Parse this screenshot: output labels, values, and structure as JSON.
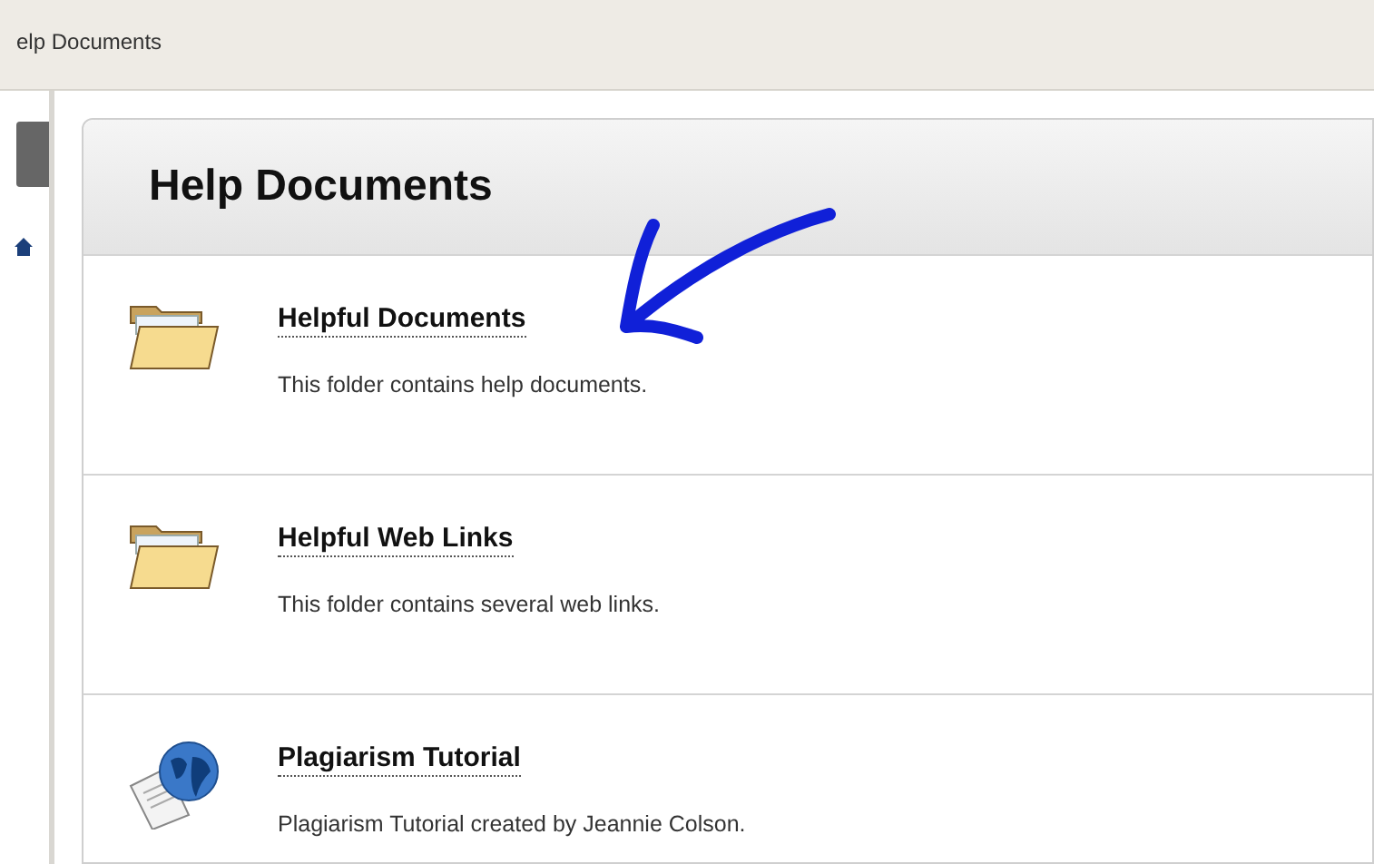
{
  "breadcrumb": "elp Documents",
  "page": {
    "title": "Help Documents"
  },
  "items": [
    {
      "kind": "folder",
      "title": "Helpful Documents",
      "description": "This folder contains help documents."
    },
    {
      "kind": "folder",
      "title": "Helpful Web Links",
      "description": "This folder contains several web links."
    },
    {
      "kind": "globe",
      "title": "Plagiarism Tutorial",
      "description": "Plagiarism Tutorial created by Jeannie Colson."
    }
  ]
}
